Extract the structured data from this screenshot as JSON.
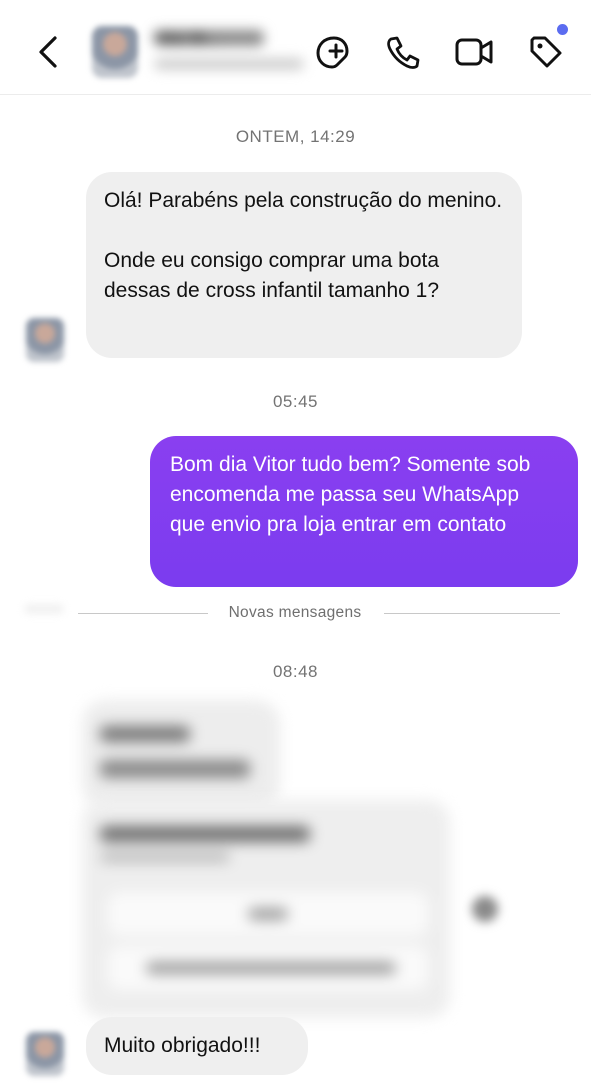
{
  "header": {
    "back_icon": "chevron-left-icon",
    "contact_name": "Vitor Br...",
    "contact_subtitle": "blurred",
    "actions": [
      "sticker-icon",
      "phone-icon",
      "video-icon",
      "tag-icon"
    ],
    "notification_dot_color": "#5b6cf0"
  },
  "messages": {
    "t1": "ONTEM, 14:29",
    "m1": "Olá! Parabéns pela construção do menino.\n\nOnde eu consigo comprar uma bota dessas de cross infantil tamanho 1?",
    "t2": "05:45",
    "m2": "Bom dia Vitor tudo bem? Somente sob encomenda me passa seu WhatsApp que envio pra loja entrar em contato",
    "divider": "Novas mensagens",
    "t3": "08:48",
    "m3": "Muito obrigado!!!"
  },
  "colors": {
    "outgoing_bubble": "#8a3ff0",
    "incoming_bubble": "#efefef"
  }
}
